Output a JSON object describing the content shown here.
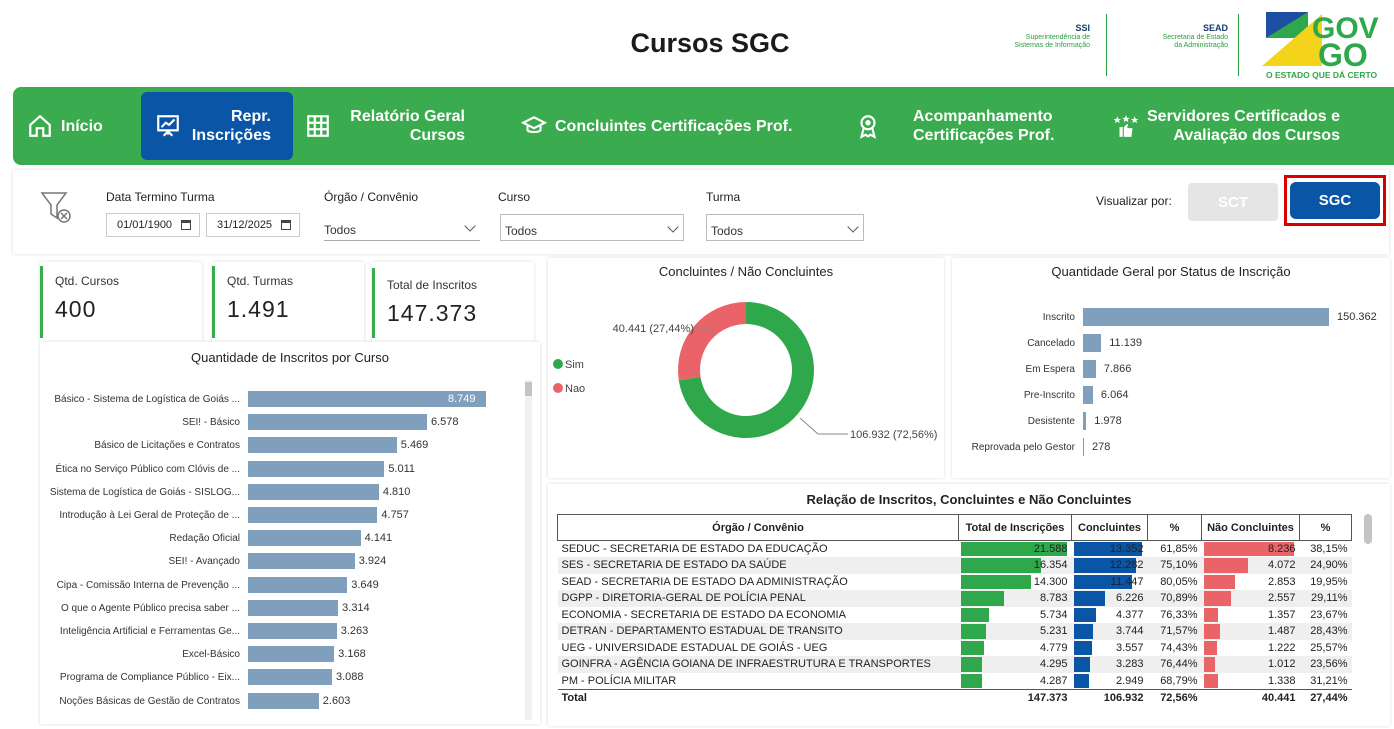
{
  "header": {
    "title": "Cursos SGC",
    "ssi": {
      "abbr": "SSI",
      "line1": "Superintendência de",
      "line2": "Sistemas de Informação"
    },
    "sead": {
      "abbr": "SEAD",
      "line1": "Secretaria de Estado",
      "line2": "da Administração"
    },
    "gov_logo": {
      "top": "GOV",
      "bottom": "GO",
      "tagline": "O ESTADO QUE DÁ CERTO"
    }
  },
  "nav": [
    {
      "label1": "Início",
      "label2": "",
      "icon": "home-icon",
      "active": false
    },
    {
      "label1": "Repr.",
      "label2": "Inscrições",
      "icon": "presentation-chart-icon",
      "active": true
    },
    {
      "label1": "Relatório Geral",
      "label2": "Cursos",
      "icon": "table-grid-icon",
      "active": false
    },
    {
      "label1": "Concluintes Certificações Prof.",
      "label2": "",
      "icon": "graduation-cap-icon",
      "active": false
    },
    {
      "label1": "Acompanhamento",
      "label2": "Certificações Prof.",
      "icon": "award-ribbon-icon",
      "active": false
    },
    {
      "label1": "Servidores Certificados e",
      "label2": "Avaliação dos Cursos",
      "icon": "stars-thumbs-up-icon",
      "active": false
    }
  ],
  "filters": {
    "date_label": "Data Termino Turma",
    "date_start": "01/01/1900",
    "date_end": "31/12/2025",
    "orgao_label": "Órgão / Convênio",
    "orgao_value": "Todos",
    "curso_label": "Curso",
    "curso_value": "Todos",
    "turma_label": "Turma",
    "turma_value": "Todos",
    "view_label": "Visualizar por:",
    "btn_sct": "SCT",
    "btn_sgc": "SGC"
  },
  "kpis": [
    {
      "label": "Qtd. Cursos",
      "value": "400"
    },
    {
      "label": "Qtd. Turmas",
      "value": "1.491"
    },
    {
      "label": "Total de Inscritos",
      "value": "147.373"
    }
  ],
  "courses_chart": {
    "title": "Quantidade de Inscritos por Curso"
  },
  "donut_chart": {
    "title": "Concluintes / Não Concluintes",
    "legend_sim": "Sim",
    "legend_nao": "Nao",
    "label_nao": "40.441 (27,44%)",
    "label_sim": "106.932 (72,56%)",
    "color_sim": "#2ea84a",
    "color_nao": "#ea6369"
  },
  "status_chart": {
    "title": "Quantidade Geral por Status de Inscrição"
  },
  "table": {
    "title": "Relação de Inscritos, Concluintes e Não Concluintes",
    "headers": [
      "Órgão / Convênio",
      "Total de Inscrições",
      "Concluintes",
      "%",
      "Não Concluintes",
      "%"
    ],
    "rows": [
      [
        "SEDUC - SECRETARIA DE ESTADO DA EDUCAÇÃO",
        "21.588",
        "13.352",
        "61,85%",
        "8.236",
        "38,15%"
      ],
      [
        "SES - SECRETARIA DE ESTADO DA SAÚDE",
        "16.354",
        "12.282",
        "75,10%",
        "4.072",
        "24,90%"
      ],
      [
        "SEAD - SECRETARIA DE ESTADO DA ADMINISTRAÇÃO",
        "14.300",
        "11.447",
        "80,05%",
        "2.853",
        "19,95%"
      ],
      [
        "DGPP - DIRETORIA-GERAL DE POLÍCIA PENAL",
        "8.783",
        "6.226",
        "70,89%",
        "2.557",
        "29,11%"
      ],
      [
        "ECONOMIA - SECRETARIA DE ESTADO DA ECONOMIA",
        "5.734",
        "4.377",
        "76,33%",
        "1.357",
        "23,67%"
      ],
      [
        "DETRAN - DEPARTAMENTO ESTADUAL DE TRANSITO",
        "5.231",
        "3.744",
        "71,57%",
        "1.487",
        "28,43%"
      ],
      [
        "UEG - UNIVERSIDADE ESTADUAL DE GOIÁS - UEG",
        "4.779",
        "3.557",
        "74,43%",
        "1.222",
        "25,57%"
      ],
      [
        "GOINFRA - AGÊNCIA GOIANA DE INFRAESTRUTURA E TRANSPORTES",
        "4.295",
        "3.283",
        "76,44%",
        "1.012",
        "23,56%"
      ],
      [
        "PM - POLÍCIA MILITAR",
        "4.287",
        "2.949",
        "68,79%",
        "1.338",
        "31,21%"
      ]
    ],
    "bar_total": [
      21588,
      16354,
      14300,
      8783,
      5734,
      5231,
      4779,
      4295,
      4287
    ],
    "bar_concl": [
      13352,
      12282,
      11447,
      6226,
      4377,
      3744,
      3557,
      3283,
      2949
    ],
    "bar_nao": [
      8236,
      4072,
      2853,
      2557,
      1357,
      1487,
      1222,
      1012,
      1338
    ],
    "total_row": [
      "Total",
      "147.373",
      "106.932",
      "72,56%",
      "40.441",
      "27,44%"
    ]
  },
  "chart_data": [
    {
      "type": "bar",
      "orientation": "horizontal",
      "title": "Quantidade de Inscritos por Curso",
      "categories": [
        "Básico - Sistema de Logística de Goiás ...",
        "SEI! - Básico",
        "Básico de Licitações e Contratos",
        "Ética no Serviço Público com Clóvis de ...",
        "Sistema de Logística de Goiás - SISLOG...",
        "Introdução à Lei Geral de Proteção de ...",
        "Redação Oficial",
        "SEI! - Avançado",
        "Cipa - Comissão Interna de Prevenção ...",
        "O que o Agente Público precisa saber ...",
        "Inteligência Artificial e Ferramentas Ge...",
        "Excel-Básico",
        "Programa de Compliance Público - Eix...",
        "Noções Básicas de Gestão de Contratos"
      ],
      "values": [
        8749,
        6578,
        5469,
        5011,
        4810,
        4757,
        4141,
        3924,
        3649,
        3314,
        3263,
        3168,
        3088,
        2603
      ],
      "value_labels": [
        "8.749",
        "6.578",
        "5.469",
        "5.011",
        "4.810",
        "4.757",
        "4.141",
        "3.924",
        "3.649",
        "3.314",
        "3.263",
        "3.168",
        "3.088",
        "2.603"
      ],
      "color": "#7f9fbd"
    },
    {
      "type": "pie",
      "title": "Concluintes / Não Concluintes",
      "categories": [
        "Sim",
        "Nao"
      ],
      "values": [
        106932,
        40441
      ],
      "value_labels": [
        "106.932 (72,56%)",
        "40.441 (27,44%)"
      ],
      "legend": "left"
    },
    {
      "type": "bar",
      "orientation": "horizontal",
      "title": "Quantidade Geral por Status de Inscrição",
      "categories": [
        "Inscrito",
        "Cancelado",
        "Em Espera",
        "Pre-Inscrito",
        "Desistente",
        "Reprovada pelo Gestor"
      ],
      "values": [
        150362,
        11139,
        7866,
        6064,
        1978,
        278
      ],
      "value_labels": [
        "150.362",
        "11.139",
        "7.866",
        "6.064",
        "1.978",
        "278"
      ],
      "color": "#7f9fbd"
    }
  ]
}
